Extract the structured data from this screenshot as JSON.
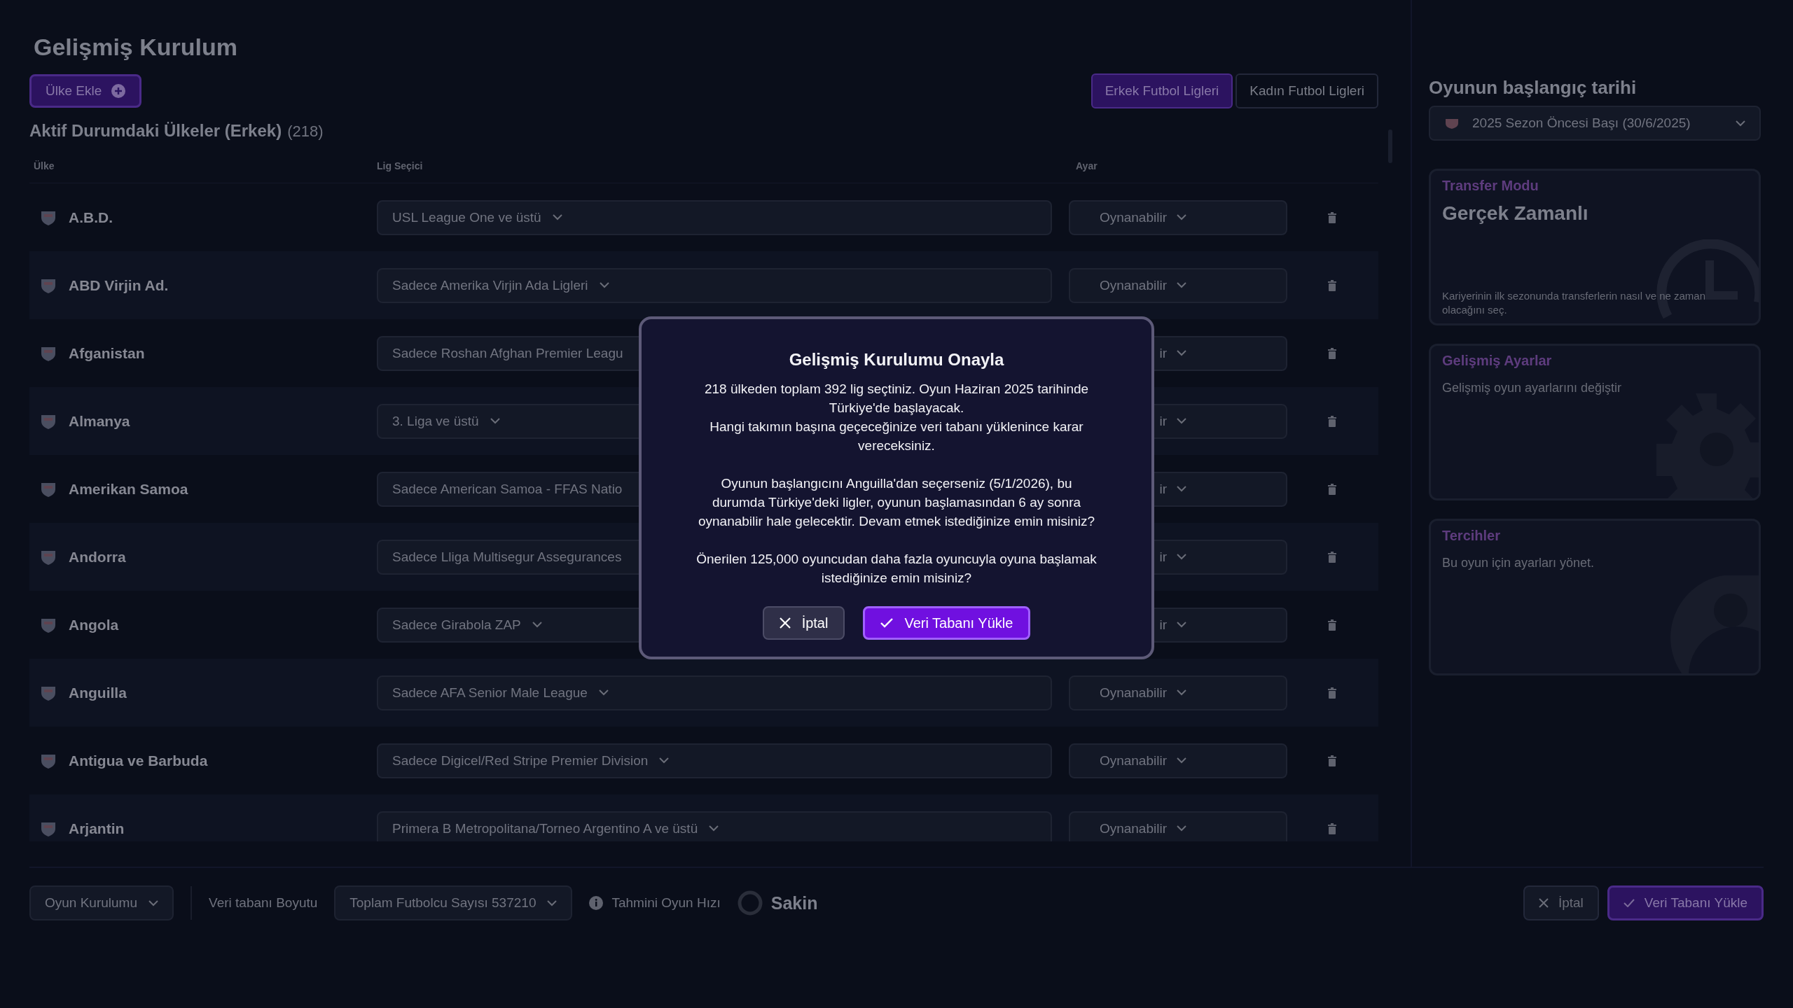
{
  "page_title": "Gelişmiş Kurulum",
  "add_country_button": "Ülke Ekle",
  "gender_tabs": [
    {
      "label": "Erkek Futbol Ligleri",
      "selected": true
    },
    {
      "label": "Kadın Futbol Ligleri",
      "selected": false
    }
  ],
  "section_title": "Aktif Durumdaki Ülkeler (Erkek)",
  "section_count": "(218)",
  "table": {
    "columns": [
      "Ülke",
      "Lig Seçici",
      "Ayar"
    ],
    "rows": [
      {
        "country": "A.B.D.",
        "league": "USL League One ve üstü",
        "setting": "Oynanabilir"
      },
      {
        "country": "ABD Virjin Ad.",
        "league": "Sadece Amerika Virjin Ada Ligleri",
        "setting": "Oynanabilir"
      },
      {
        "country": "Afganistan",
        "league": "Sadece Roshan Afghan Premier Leagu",
        "league_arrow": false,
        "setting": "ir"
      },
      {
        "country": "Almanya",
        "league": "3. Liga ve üstü",
        "setting": "ir"
      },
      {
        "country": "Amerikan Samoa",
        "league": "Sadece American Samoa - FFAS Natio",
        "league_arrow": false,
        "setting": "ir"
      },
      {
        "country": "Andorra",
        "league": "Sadece Lliga Multisegur Assegurances",
        "league_arrow": false,
        "setting": "ir"
      },
      {
        "country": "Angola",
        "league": "Sadece Girabola ZAP",
        "setting": "ir"
      },
      {
        "country": "Anguilla",
        "league": "Sadece AFA Senior Male League",
        "setting": "Oynanabilir"
      },
      {
        "country": "Antigua ve Barbuda",
        "league": "Sadece Digicel/Red Stripe Premier Division",
        "setting": "Oynanabilir"
      },
      {
        "country": "Arjantin",
        "league": "Primera B Metropolitana/Torneo Argentino A ve üstü",
        "setting": "Oynanabilir"
      }
    ]
  },
  "start_date": {
    "label": "Oyunun başlangıç tarihi",
    "value": "2025 Sezon Öncesi Başı (30/6/2025)"
  },
  "cards": [
    {
      "kind": "clock",
      "title": "Transfer Modu",
      "value": "Gerçek Zamanlı",
      "description": "Kariyerinin ilk sezonunda transferlerin nasıl ve ne zaman olacağını seç."
    },
    {
      "kind": "gear",
      "title": "Gelişmiş Ayarlar",
      "description": "Gelişmiş oyun ayarlarını değiştir"
    },
    {
      "kind": "person",
      "title": "Tercihler",
      "description": "Bu oyun için ayarları yönet."
    }
  ],
  "footer": {
    "setup_dropdown": "Oyun Kurulumu",
    "size_label": "Veri tabanı Boyutu",
    "size_dropdown": "Toplam Futbolcu Sayısı 537210",
    "speed_label": "Tahmini Oyun Hızı",
    "speed_value": "Sakin",
    "cancel_button": "İptal",
    "load_button": "Veri Tabanı Yükle"
  },
  "dialog": {
    "title": "Gelişmiş Kurulumu Onayla",
    "paragraphs": [
      [
        "218 ülkeden toplam 392 lig seçtiniz. Oyun Haziran 2025 tarihinde Türkiye'de başlayacak.",
        "Hangi takımın başına geçeceğinize veri tabanı yüklenince karar vereceksiniz."
      ],
      [
        "Oyunun başlangıcını Anguilla'dan seçerseniz (5/1/2026), bu durumda Türkiye'deki ligler, oyunun başlamasından 6 ay sonra oynanabilir hale gelecektir. Devam etmek istediğinize emin misiniz?"
      ],
      [
        "Önerilen 125,000 oyuncudan daha fazla oyuncuyla oyuna başlamak istediğinize emin misiniz?"
      ]
    ],
    "cancel_button": "İptal",
    "confirm_button": "Veri Tabanı Yükle"
  }
}
